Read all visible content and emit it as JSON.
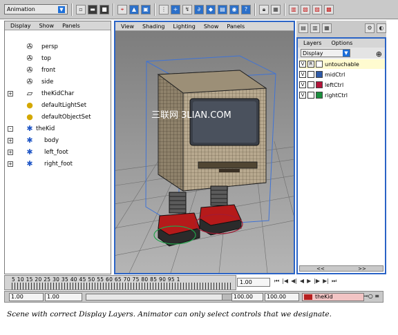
{
  "shelf": {
    "mode": "Animation",
    "icons": [
      "new-scene-icon",
      "open-scene-icon",
      "save-scene-icon",
      "select-hierarchy-icon",
      "select-object-icon",
      "select-component-icon",
      "snap-grid-icon",
      "snap-curve-icon",
      "snap-point-icon",
      "snap-surface-icon",
      "history-icon",
      "render-icon",
      "ipr-icon",
      "render-settings-icon",
      "hypershade-icon",
      "help-icon",
      "attribute-editor-icon",
      "tool-settings-icon",
      "channel-box-icon"
    ]
  },
  "outliner": {
    "menu": [
      "Display",
      "Show",
      "Panels"
    ],
    "items": [
      {
        "label": "persp",
        "icon": "camera-icon",
        "expand": ""
      },
      {
        "label": "top",
        "icon": "camera-icon",
        "expand": ""
      },
      {
        "label": "front",
        "icon": "camera-icon",
        "expand": ""
      },
      {
        "label": "side",
        "icon": "camera-icon",
        "expand": ""
      },
      {
        "label": "theKidChar",
        "icon": "character-set-icon",
        "expand": "+"
      },
      {
        "label": "defaultLightSet",
        "icon": "light-set-icon",
        "expand": ""
      },
      {
        "label": "defaultObjectSet",
        "icon": "object-set-icon",
        "expand": ""
      },
      {
        "label": "theKid",
        "icon": "joint-icon",
        "expand": "-"
      },
      {
        "label": "body",
        "icon": "joint-icon",
        "expand": "+"
      },
      {
        "label": "left_foot",
        "icon": "joint-icon",
        "expand": "+"
      },
      {
        "label": "right_foot",
        "icon": "joint-icon",
        "expand": "+"
      }
    ]
  },
  "viewport": {
    "menu": [
      "View",
      "Shading",
      "Lighting",
      "Show",
      "Panels"
    ],
    "watermark": "三联网 3LIAN.COM"
  },
  "layers": {
    "tabs": [
      "Layers",
      "Options"
    ],
    "display_mode": "Display",
    "rows": [
      {
        "name": "untouchable",
        "v": "V",
        "r": "R",
        "color": "#ffffff"
      },
      {
        "name": "midCtrl",
        "v": "V",
        "r": "",
        "color": "#2d5aa8"
      },
      {
        "name": "leftCtrl",
        "v": "V",
        "r": "",
        "color": "#b3143a"
      },
      {
        "name": "rightCtrl",
        "v": "V",
        "r": "",
        "color": "#1b8f3e"
      }
    ],
    "scroll": [
      "<<",
      ">>"
    ]
  },
  "timeline": {
    "frames": "5   10  15  20  25  30  35  40  45  50  55  60  65  70  75  80  85  90  95  1",
    "current": "1.00"
  },
  "range": {
    "start": "1.00",
    "start2": "1.00",
    "end": "100.00",
    "end2": "100.00",
    "character": "theKid"
  },
  "caption": "Scene with correct Display Layers.  Animator can only select controls that we designate."
}
